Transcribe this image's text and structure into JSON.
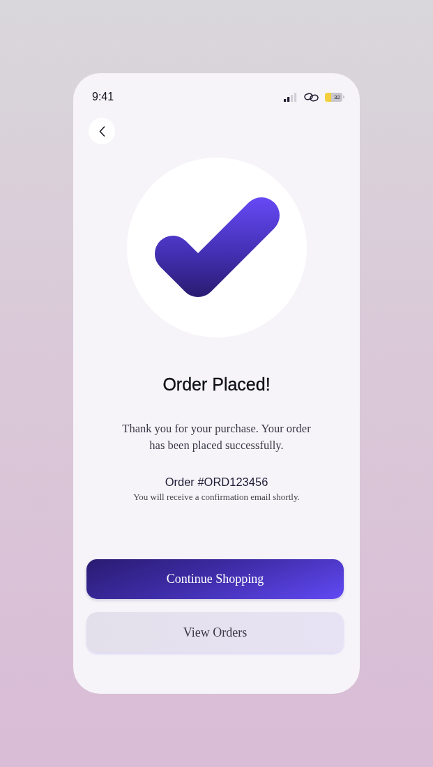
{
  "status_bar": {
    "time": "9:41",
    "battery": "32"
  },
  "success": {
    "title": "Order Placed!",
    "message": "Thank you for your purchase. Your order has been placed successfully.",
    "order_number": "Order #ORD123456",
    "note": "You will receive a confirmation email shortly."
  },
  "buttons": [
    {
      "label": "Continue Shopping",
      "kind": "primary"
    },
    {
      "label": "View Orders",
      "kind": "secondary"
    }
  ]
}
